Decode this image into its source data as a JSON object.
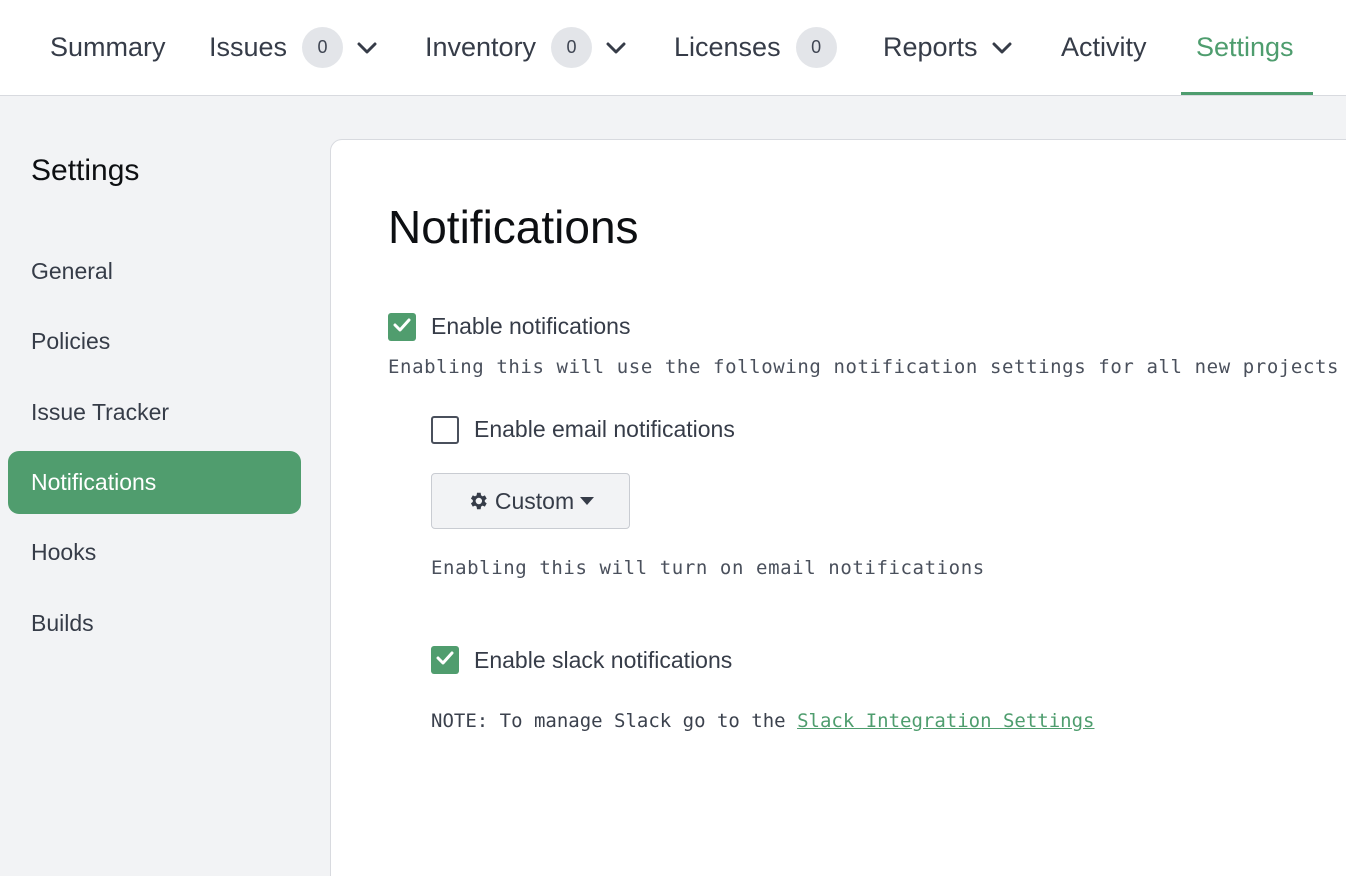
{
  "topnav": {
    "tabs": [
      {
        "label": "Summary"
      },
      {
        "label": "Issues",
        "badge": "0",
        "dropdown": true
      },
      {
        "label": "Inventory",
        "badge": "0",
        "dropdown": true
      },
      {
        "label": "Licenses",
        "badge": "0"
      },
      {
        "label": "Reports",
        "dropdown": true
      },
      {
        "label": "Activity"
      },
      {
        "label": "Settings",
        "active": true
      }
    ]
  },
  "sidebar": {
    "title": "Settings",
    "items": [
      {
        "label": "General"
      },
      {
        "label": "Policies"
      },
      {
        "label": "Issue Tracker"
      },
      {
        "label": "Notifications",
        "active": true
      },
      {
        "label": "Hooks"
      },
      {
        "label": "Builds"
      }
    ]
  },
  "main": {
    "title": "Notifications",
    "enable_notifications": {
      "label": "Enable notifications",
      "checked": true
    },
    "enable_notifications_help": "Enabling this will use the following notification settings for all new projects",
    "email": {
      "label": "Enable email notifications",
      "checked": false
    },
    "custom_button": {
      "label": "Custom"
    },
    "email_help": "Enabling this will turn on email notifications",
    "slack": {
      "label": "Enable slack notifications",
      "checked": true
    },
    "slack_note_prefix": "NOTE: To manage Slack go to the",
    "slack_link": "Slack Integration Settings"
  },
  "colors": {
    "accent": "#509d6e",
    "badge_bg": "#e3e5e9",
    "page_bg": "#f2f3f5"
  }
}
